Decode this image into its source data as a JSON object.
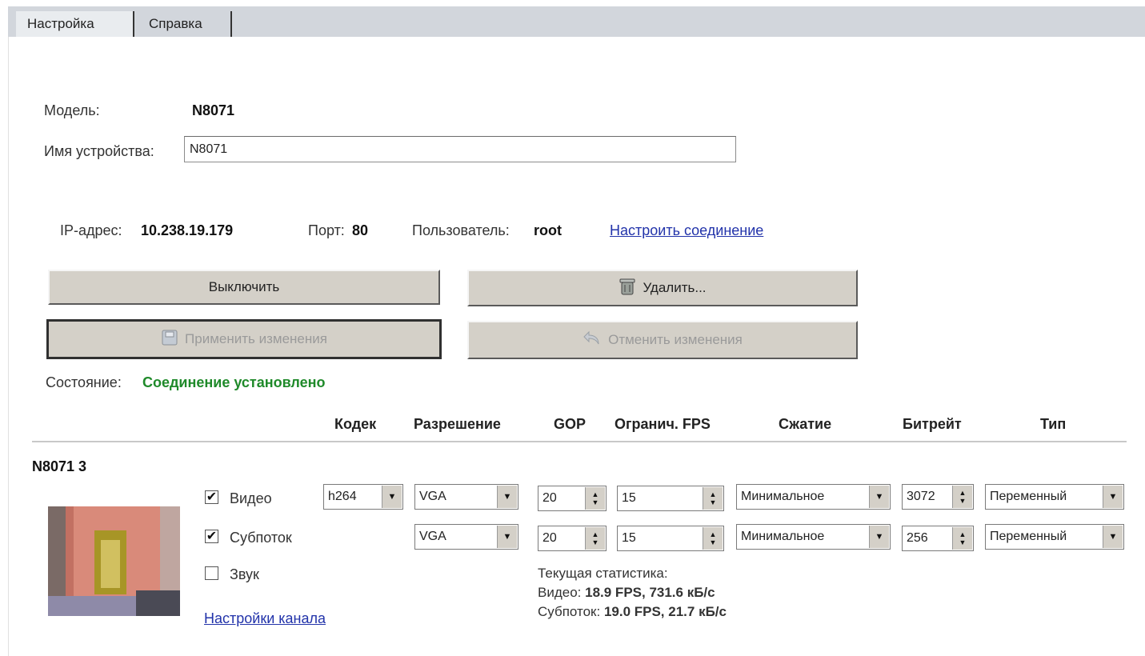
{
  "tabs": {
    "settings": "Настройка",
    "help": "Справка"
  },
  "device": {
    "model_label": "Модель:",
    "model_value": "N8071",
    "name_label": "Имя устройства:",
    "name_value": "N8071"
  },
  "connection": {
    "ip_label": "IP-адрес:",
    "ip_value": "10.238.19.179",
    "port_label": "Порт:",
    "port_value": "80",
    "user_label": "Пользователь:",
    "user_value": "root",
    "configure_link": "Настроить соединение"
  },
  "buttons": {
    "turn_off": "Выключить",
    "delete": "Удалить...",
    "apply": "Применить изменения",
    "cancel": "Отменить изменения"
  },
  "status": {
    "label": "Состояние:",
    "value": "Соединение установлено"
  },
  "columns": [
    "Кодек",
    "Разрешение",
    "GOP",
    "Огранич. FPS",
    "Сжатие",
    "Битрейт",
    "Тип"
  ],
  "channel": {
    "title": "N8071 3",
    "video": {
      "label": "Видео",
      "checked": true,
      "codec": "h264",
      "resolution": "VGA",
      "gop": "20",
      "fps": "15",
      "compression": "Минимальное",
      "bitrate": "3072",
      "type": "Переменный"
    },
    "substream": {
      "label": "Субпоток",
      "checked": true,
      "resolution": "VGA",
      "gop": "20",
      "fps": "15",
      "compression": "Минимальное",
      "bitrate": "256",
      "type": "Переменный"
    },
    "sound": {
      "label": "Звук",
      "checked": false
    },
    "settings_link": "Настройки канала",
    "stats": {
      "title": "Текущая статистика:",
      "video_label": "Видео:",
      "video_value": "18.9 FPS, 731.6 кБ/с",
      "sub_label": "Субпоток:",
      "sub_value": "19.0 FPS, 21.7 кБ/с"
    }
  }
}
